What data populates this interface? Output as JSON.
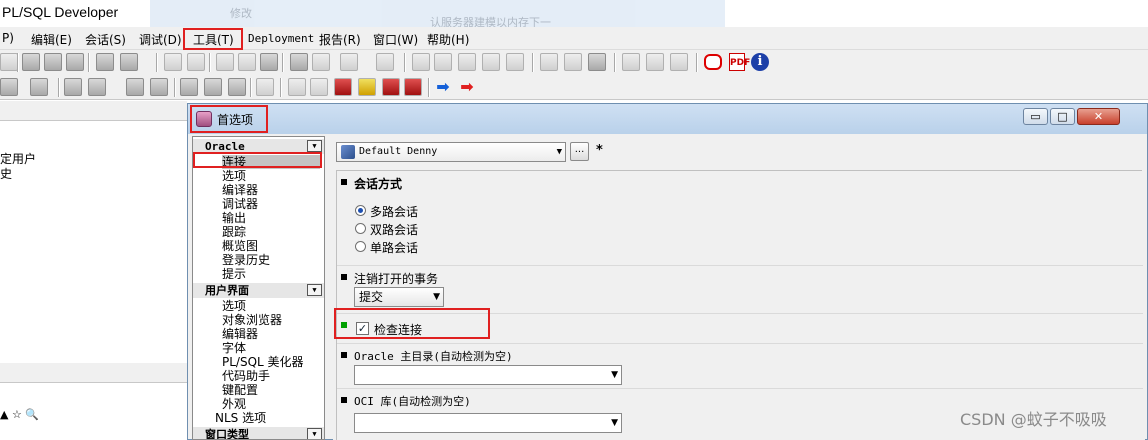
{
  "app": {
    "title": "PL/SQL Developer"
  },
  "background_ghost": {
    "text1": "修改",
    "text2": "认服务器建模以内存下一"
  },
  "menubar": {
    "items": [
      "P)",
      "编辑(E)",
      "会话(S)",
      "调试(D)",
      "工具(T)",
      "Deployment",
      "报告(R)",
      "窗口(W)",
      "帮助(H)"
    ]
  },
  "left_panel": {
    "item1": "定用户",
    "item2": "史",
    "bottom_icons": "▲ ☆ 🔍"
  },
  "dialog": {
    "title": "首选项",
    "controls": {
      "minimize": "▭",
      "maximize": "□",
      "close": "✕"
    }
  },
  "tree": {
    "sections": [
      {
        "header": "Oracle",
        "items": [
          "连接",
          "选项",
          "编译器",
          "调试器",
          "输出",
          "跟踪",
          "概览图",
          "登录历史",
          "提示"
        ]
      },
      {
        "header": "用户界面",
        "items": [
          "选项",
          "对象浏览器",
          "编辑器",
          "字体",
          "PL/SQL 美化器",
          "代码助手",
          "键配置",
          "外观",
          "NLS 选项"
        ]
      },
      {
        "header": "窗口类型",
        "items": []
      }
    ]
  },
  "settings": {
    "preset": "Default Denny",
    "more_button": "...",
    "modified_indicator": "*",
    "session_mode": {
      "title": "会话方式",
      "options": [
        "多路会话",
        "双路会话",
        "单路会话"
      ],
      "selected": "多路会话"
    },
    "logoff_transaction": {
      "title": "注销打开的事务",
      "value": "提交"
    },
    "check_connection": {
      "label": "检查连接",
      "checked": true
    },
    "oracle_home": {
      "title": "Oracle 主目录(自动检测为空)",
      "value": ""
    },
    "oci_library": {
      "title": "OCI 库(自动检测为空)",
      "value": ""
    }
  },
  "watermark": "CSDN @蚊子不吸吸"
}
